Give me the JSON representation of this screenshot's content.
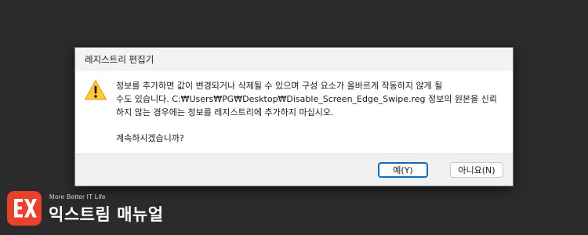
{
  "dialog": {
    "title": "레지스트리 편집기",
    "icon": "warning-icon",
    "message_line1": "정보를 추가하면 값이 변경되거나 삭제될 수 있으며 구성 요소가 올바르게 작동하지 않게 될",
    "message_line2": "수도 있습니다. C:₩Users₩PG₩Desktop₩Disable_Screen_Edge_Swipe.reg 정보의 원본을 신뢰",
    "message_line3": "하지 않는 경우에는 정보를 레지스트리에 추가하지 마십시오.",
    "question": "계속하시겠습니까?",
    "yes_button": "예(Y)",
    "no_button": "아니요(N)"
  },
  "branding": {
    "logo_icon": "ex-logo-icon",
    "tagline": "More Better IT Life",
    "name": "익스트림 매뉴얼",
    "accent_color": "#e8412c"
  }
}
